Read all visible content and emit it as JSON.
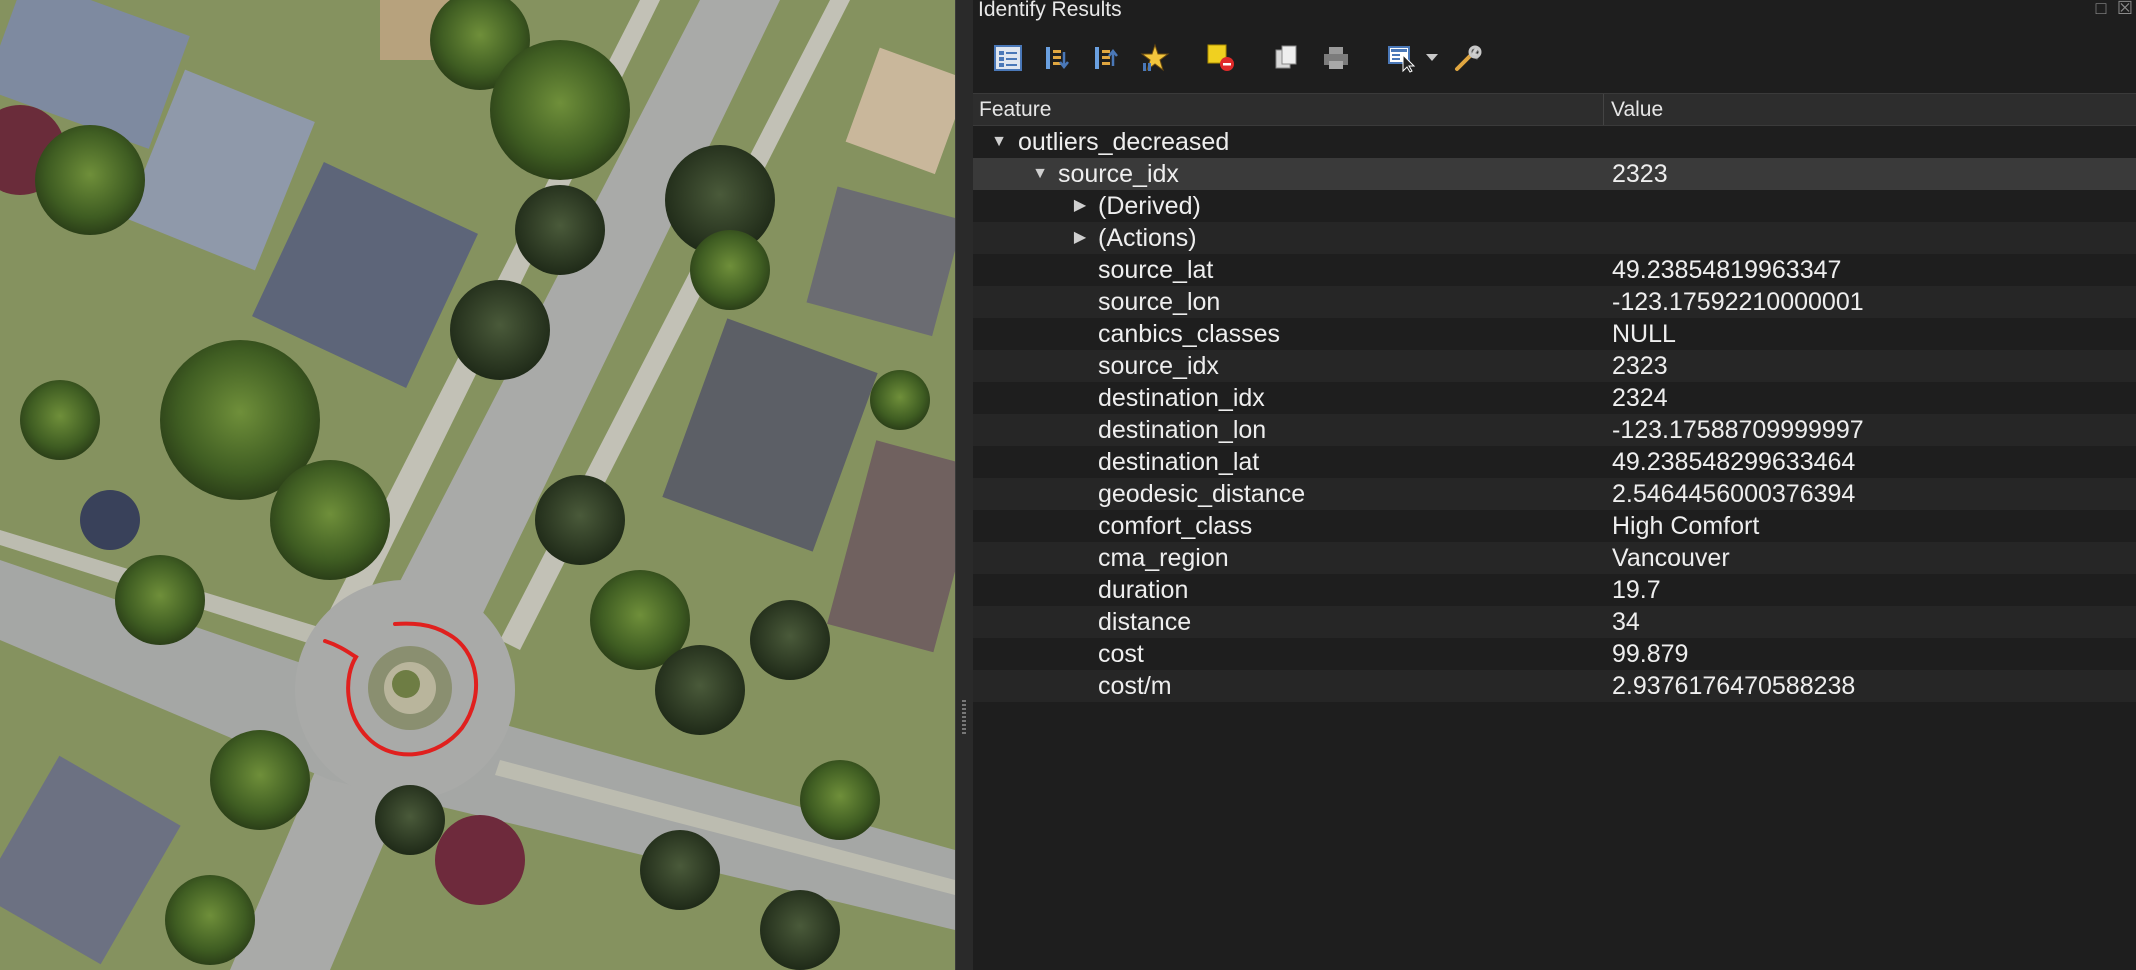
{
  "panel": {
    "title": "Identify Results",
    "toolbar_icons": [
      "expand-tree-icon",
      "expand-all-icon",
      "collapse-all-icon",
      "highlight-icon",
      "clear-selection-icon",
      "copy-icon",
      "print-icon",
      "identify-mode-icon",
      "dropdown-icon",
      "settings-icon"
    ]
  },
  "table": {
    "headers": {
      "feature": "Feature",
      "value": "Value"
    },
    "layer": {
      "name": "outliers_decreased"
    },
    "feature_node": {
      "name": "source_idx",
      "value": "2323"
    },
    "groups": [
      {
        "label": "(Derived)"
      },
      {
        "label": "(Actions)"
      }
    ],
    "attributes": [
      {
        "name": "source_lat",
        "value": "49.23854819963347"
      },
      {
        "name": "source_lon",
        "value": "-123.17592210000001"
      },
      {
        "name": "canbics_classes",
        "value": "NULL"
      },
      {
        "name": "source_idx",
        "value": "2323"
      },
      {
        "name": "destination_idx",
        "value": "2324"
      },
      {
        "name": "destination_lon",
        "value": "-123.17588709999997"
      },
      {
        "name": "destination_lat",
        "value": "49.238548299633464"
      },
      {
        "name": "geodesic_distance",
        "value": "2.5464456000376394"
      },
      {
        "name": "comfort_class",
        "value": "High Comfort"
      },
      {
        "name": "cma_region",
        "value": "Vancouver"
      },
      {
        "name": "duration",
        "value": "19.7"
      },
      {
        "name": "distance",
        "value": "34"
      },
      {
        "name": "cost",
        "value": "99.879"
      },
      {
        "name": "cost/m",
        "value": "2.9376176470588238"
      }
    ]
  },
  "colors": {
    "route": "#e0201e",
    "panel_bg": "#1e1e1e",
    "selected_row": "#3a3a3a"
  }
}
